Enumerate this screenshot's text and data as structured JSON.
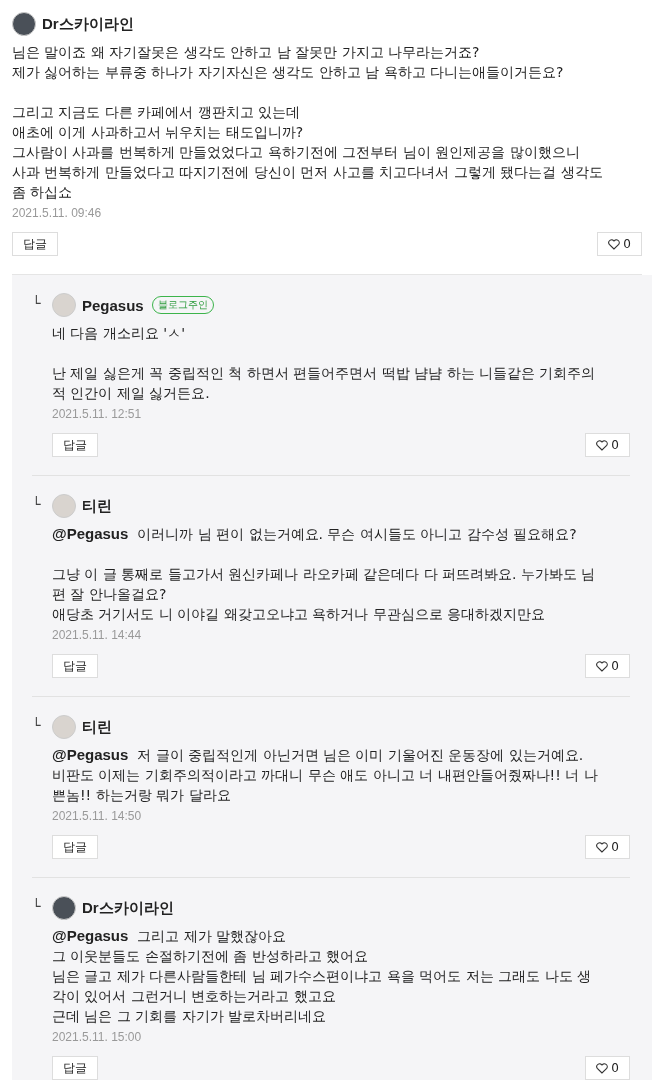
{
  "comment": {
    "author": "Dr스카이라인",
    "paragraphs": [
      [
        "님은 말이죠 왜 자기잘못은 생각도 안하고 남 잘못만 가지고 나무라는거죠?",
        "제가 싫어하는 부류중 하나가 자기자신은 생각도 안하고 남 욕하고 다니는애들이거든요?"
      ],
      [
        "그리고 지금도 다른 카페에서 깽판치고 있는데",
        "애초에 이게 사과하고서 뉘우치는 태도입니까?",
        "그사람이 사과를 번복하게 만들었었다고 욕하기전에 그전부터 님이 원인제공을 많이했으니",
        "사과 번복하게 만들었다고 따지기전에 당신이 먼저 사고를 치고다녀서 그렇게 됐다는걸 생각도",
        "좀 하십쇼"
      ]
    ],
    "time": "2021.5.11. 09:46",
    "reply_button": "답글",
    "likes": "0"
  },
  "replies": [
    {
      "reply_mark": "└",
      "author": "Pegasus",
      "badge": "블로그주인",
      "paragraphs": [
        [
          "네 다음 개소리요 'ㅅ'"
        ],
        [
          "난 제일 싫은게 꼭 중립적인 척 하면서 편들어주면서 떡밥 냠냠 하는 니들같은 기회주의",
          "적 인간이 제일 싫거든요."
        ]
      ],
      "time": "2021.5.11. 12:51",
      "reply_button": "답글",
      "likes": "0"
    },
    {
      "reply_mark": "└",
      "author": "티린",
      "mention": "@Pegasus",
      "paragraphs": [
        [
          "이러니까 님 편이 없는거예요. 무슨 여시들도 아니고 감수성 필요해요?"
        ],
        [
          "그냥 이 글 통째로 들고가서 원신카페나 라오카페 같은데다 다 퍼뜨려봐요. 누가봐도 님",
          "편 잘 안나올걸요?",
          "애당초 거기서도 니 이야길 왜갖고오냐고 욕하거나 무관심으로 응대하겠지만요"
        ]
      ],
      "time": "2021.5.11. 14:44",
      "reply_button": "답글",
      "likes": "0"
    },
    {
      "reply_mark": "└",
      "author": "티린",
      "mention": "@Pegasus",
      "paragraphs": [
        [
          "저 글이 중립적인게 아닌거면 님은 이미 기울어진 운동장에 있는거예요.",
          "비판도 이제는 기회주의적이라고 까대니 무슨 애도 아니고 너 내편안들어줬짜나!! 너 나",
          "쁜놈!! 하는거랑 뭐가 달라요"
        ]
      ],
      "time": "2021.5.11. 14:50",
      "reply_button": "답글",
      "likes": "0"
    },
    {
      "reply_mark": "└",
      "author": "Dr스카이라인",
      "mention": "@Pegasus",
      "paragraphs": [
        [
          "그리고 제가 말했잖아요",
          "그 이웃분들도 손절하기전에 좀 반성하라고 했어요",
          "님은 글고 제가 다른사람들한테 님 페가수스편이냐고 욕을 먹어도 저는 그래도 나도 생",
          "각이 있어서 그런거니 변호하는거라고 했고요",
          "근데 님은 그 기회를 자기가 발로차버리네요"
        ]
      ],
      "time": "2021.5.11. 15:00",
      "reply_button": "답글",
      "likes": "0"
    }
  ]
}
